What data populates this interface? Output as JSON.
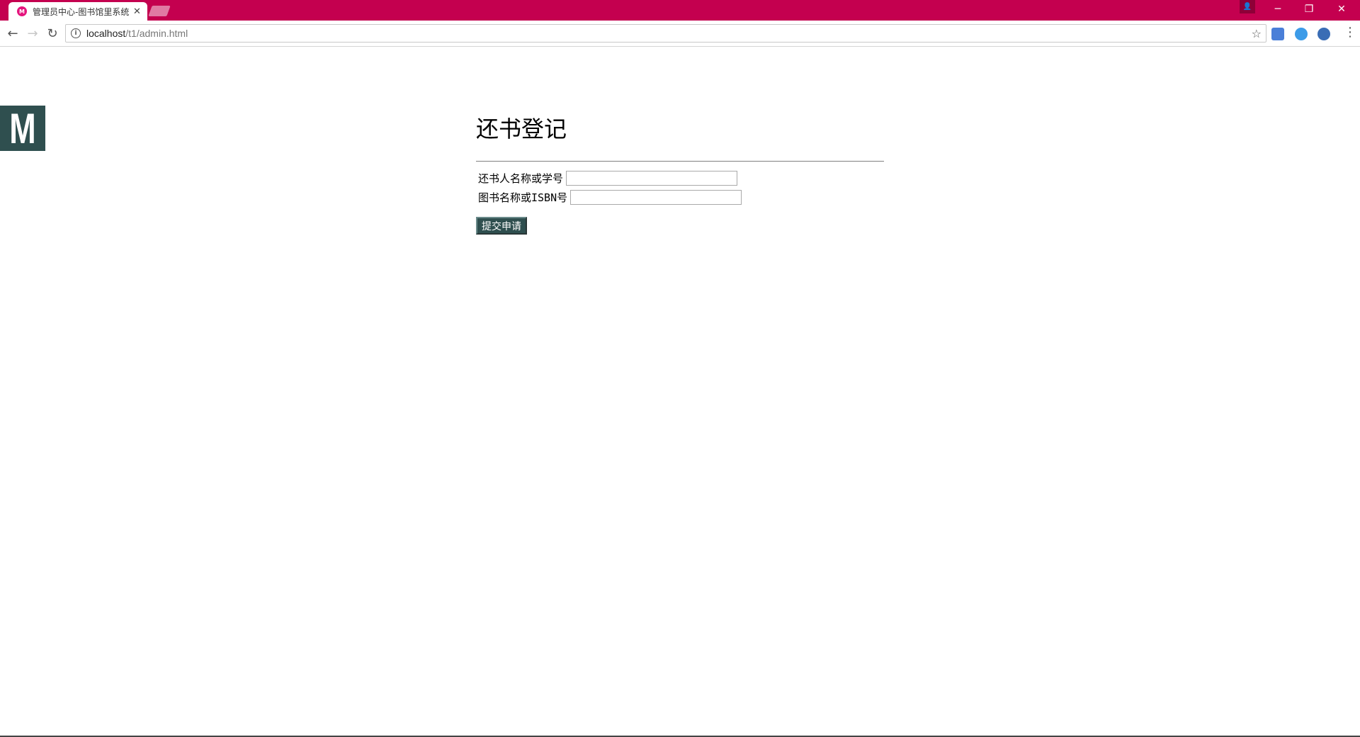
{
  "browser": {
    "tab_title": "管理员中心-图书馆里系统",
    "tab_favicon": "M",
    "url_host": "localhost",
    "url_path": "/t1/admin.html",
    "tabstrip_color": "#c4004f"
  },
  "icons": {
    "back": "←",
    "forward": "→",
    "reload": "↻",
    "info": "i",
    "star": "☆",
    "close_tab": "✕",
    "profile": "👤",
    "minimize": "─",
    "restore": "❐",
    "close_window": "✕",
    "menu": "⋮"
  },
  "page": {
    "logo_letter": "M",
    "logo_color": "#2f4f4f",
    "title": "还书登记",
    "fields": [
      {
        "label": "还书人名称或学号",
        "value": ""
      },
      {
        "label": "图书名称或ISBN号",
        "value": ""
      }
    ],
    "submit_label": "提交申请"
  }
}
